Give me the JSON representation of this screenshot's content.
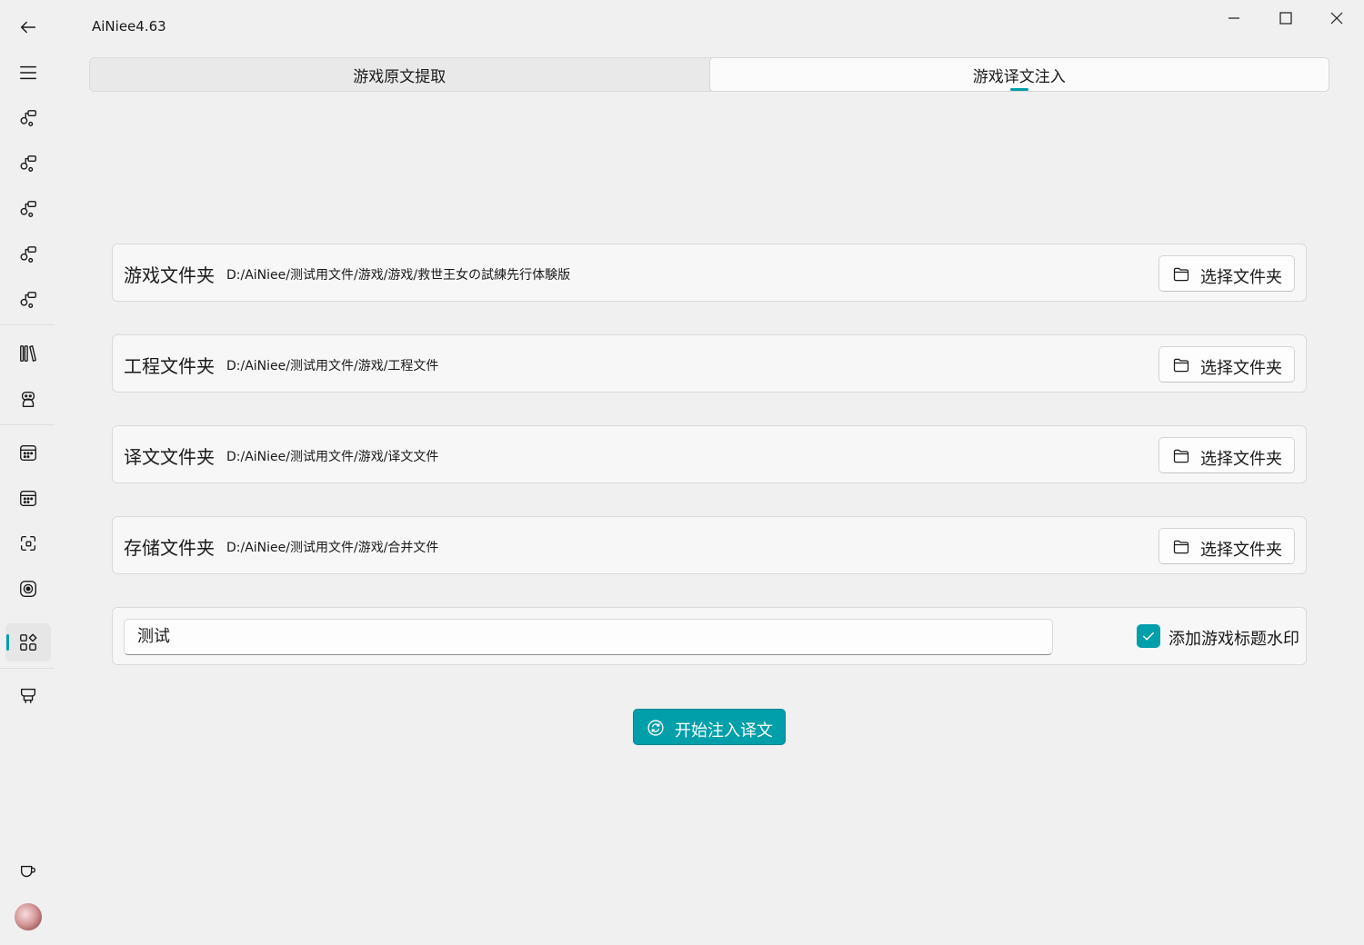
{
  "window": {
    "title": "AiNiee4.63"
  },
  "sidebar": {
    "items": [
      {
        "icon": "back-arrow-icon"
      },
      {
        "icon": "menu-icon"
      },
      {
        "icon": "link-icon"
      },
      {
        "icon": "link-icon"
      },
      {
        "icon": "link-icon"
      },
      {
        "icon": "link-icon"
      },
      {
        "icon": "link-icon"
      },
      {
        "icon": "library-icon"
      },
      {
        "icon": "robot-icon"
      },
      {
        "icon": "calendar-icon"
      },
      {
        "icon": "calendar-icon"
      },
      {
        "icon": "scan-icon"
      },
      {
        "icon": "record-icon"
      },
      {
        "icon": "apps-icon",
        "active": true
      },
      {
        "icon": "sofa-icon"
      },
      {
        "icon": "cup-icon"
      },
      {
        "icon": "avatar"
      }
    ]
  },
  "tabs": [
    {
      "label": "游戏原文提取",
      "active": false
    },
    {
      "label": "游戏译文注入",
      "active": true
    }
  ],
  "rows": [
    {
      "label": "游戏文件夹",
      "path": "D:/AiNiee/测试用文件/游戏/游戏/救世王女の試練先行体験版",
      "button": "选择文件夹"
    },
    {
      "label": "工程文件夹",
      "path": "D:/AiNiee/测试用文件/游戏/工程文件",
      "button": "选择文件夹"
    },
    {
      "label": "译文文件夹",
      "path": "D:/AiNiee/测试用文件/游戏/译文文件",
      "button": "选择文件夹"
    },
    {
      "label": "存储文件夹",
      "path": "D:/AiNiee/测试用文件/游戏/合并文件",
      "button": "选择文件夹"
    }
  ],
  "watermark": {
    "value": "测试",
    "checkbox_label": "添加游戏标题水印",
    "checked": true
  },
  "action": {
    "label": "开始注入译文"
  },
  "colors": {
    "accent": "#009faa",
    "background": "#f0f0f0",
    "card": "#f7f7f7"
  }
}
